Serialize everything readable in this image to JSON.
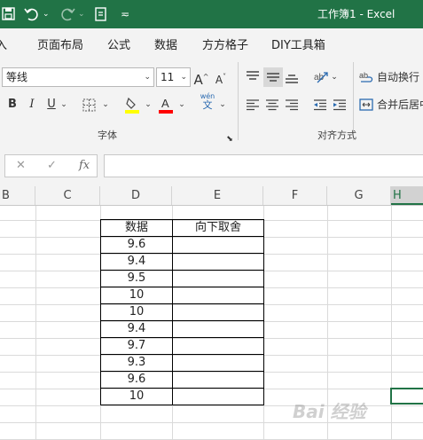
{
  "window": {
    "title": "工作簿1  -  Excel"
  },
  "quick_access": {
    "save_icon": "save-icon",
    "undo_icon": "undo-icon",
    "redo_icon": "redo-icon",
    "touch_icon": "touch-mode-icon",
    "customize_icon": "customize-qat-icon"
  },
  "tabs": [
    "插入",
    "页面布局",
    "公式",
    "数据",
    "方方格子",
    "DIY工具箱"
  ],
  "tab_insert_visible": "入",
  "font": {
    "name": "等线",
    "size": "11",
    "grow": "A",
    "shrink": "A",
    "bold": "B",
    "italic": "I",
    "underline": "U",
    "fill_color": "#FFFF00",
    "font_color": "#FF0000",
    "phonetic_top": "wén",
    "phonetic_bottom": "文"
  },
  "groups": {
    "font": "字体",
    "alignment": "对齐方式"
  },
  "alignment": {
    "wrap_text": "自动换行",
    "merge_center": "合并后居中"
  },
  "formula_bar": {
    "cancel": "✕",
    "enter": "✓",
    "fx": "fx",
    "value": ""
  },
  "columns": [
    "B",
    "C",
    "D",
    "E",
    "F",
    "G",
    "H"
  ],
  "table": {
    "headers": [
      "数据",
      "向下取舍"
    ],
    "rows": [
      [
        "9.6",
        ""
      ],
      [
        "9.4",
        ""
      ],
      [
        "9.5",
        ""
      ],
      [
        "10",
        ""
      ],
      [
        "10",
        ""
      ],
      [
        "9.4",
        ""
      ],
      [
        "9.7",
        ""
      ],
      [
        "9.3",
        ""
      ],
      [
        "9.6",
        ""
      ],
      [
        "10",
        ""
      ]
    ]
  },
  "watermark": "Bai 经验"
}
